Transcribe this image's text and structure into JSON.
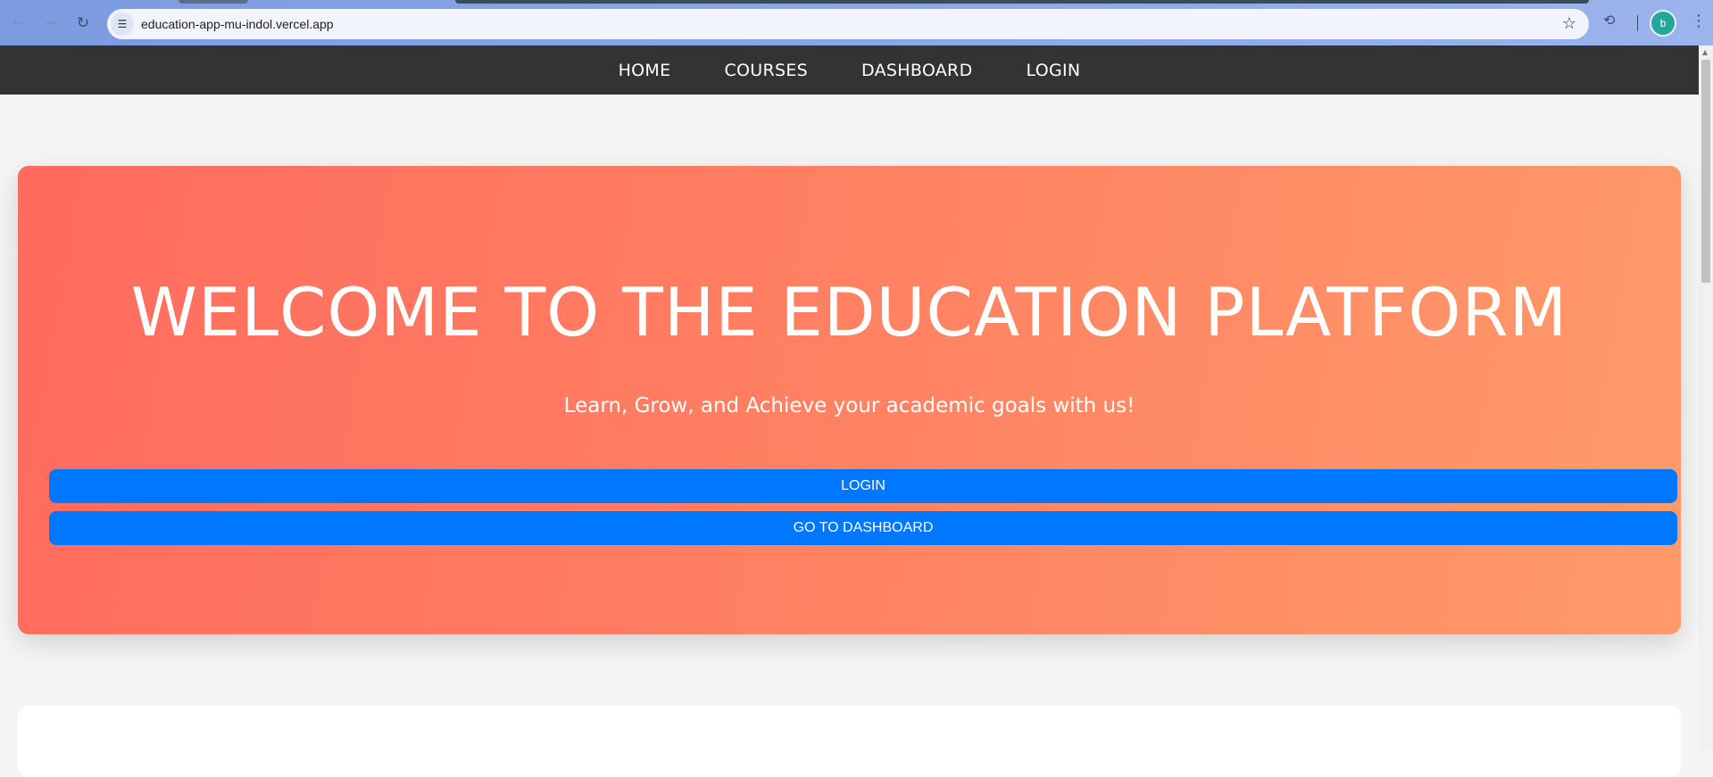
{
  "browser": {
    "url": "education-app-mu-indol.vercel.app",
    "avatar_initial": "b",
    "icons": {
      "back": "←",
      "forward": "→",
      "reload": "↻",
      "site_info": "☰",
      "bookmark": "☆",
      "history": "⟲",
      "menu": "⋮"
    }
  },
  "nav": {
    "items": [
      "HOME",
      "COURSES",
      "DASHBOARD",
      "LOGIN"
    ]
  },
  "hero": {
    "title": "WELCOME TO THE EDUCATION PLATFORM",
    "subtitle": "Learn, Grow, and Achieve your academic goals with us!",
    "login_button": "LOGIN",
    "dashboard_button": "GO TO DASHBOARD"
  },
  "colors": {
    "nav_bg": "#333333",
    "hero_gradient_start": "#ff6b5e",
    "hero_gradient_end": "#ff9a6a",
    "button_blue": "#0077ff",
    "page_bg": "#f5f5f5"
  }
}
